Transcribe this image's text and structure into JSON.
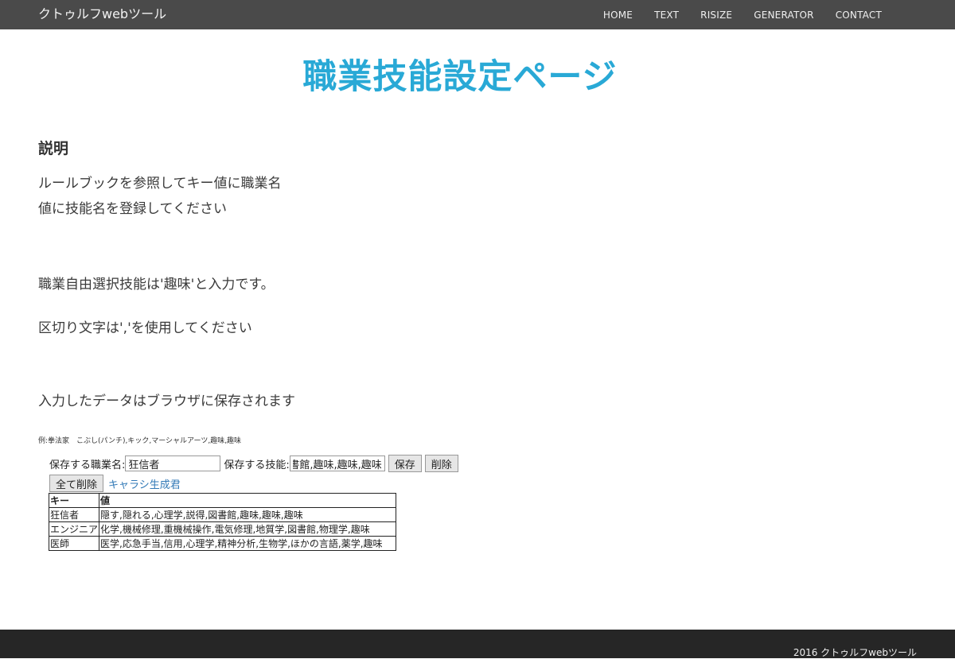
{
  "header": {
    "brand": "クトゥルフwebツール",
    "nav": [
      "HOME",
      "TEXT",
      "RISIZE",
      "GENERATOR",
      "CONTACT"
    ]
  },
  "main": {
    "title": "職業技能設定ページ",
    "section_heading": "説明",
    "descriptions": [
      "ルールブックを参照してキー値に職業名",
      "値に技能名を登録してください",
      "職業自由選択技能は'趣味'と入力です。",
      "区切り文字は','を使用してください",
      "入力したデータはブラウザに保存されます"
    ],
    "example": "例:拳法家　こぶし(パンチ),キック,マーシャルアーツ,趣味,趣味"
  },
  "form": {
    "job_label": "保存する職業名:",
    "job_value": "狂信者",
    "skill_label": "保存する技能:",
    "skill_value": "隠す,隠れる,心理学,説得,図書館,趣味,趣味,趣味",
    "save_button": "保存",
    "delete_button": "削除",
    "delete_all_button": "全て削除",
    "generator_link": "キャラシ生成君"
  },
  "table": {
    "headers": [
      "キー",
      "値"
    ],
    "rows": [
      {
        "key": "狂信者",
        "value": "隠す,隠れる,心理学,説得,図書館,趣味,趣味,趣味"
      },
      {
        "key": "エンジニア",
        "value": "化学,機械修理,重機械操作,電気修理,地質学,図書館,物理学,趣味"
      },
      {
        "key": "医師",
        "value": "医学,応急手当,信用,心理学,精神分析,生物学,ほかの言語,薬学,趣味"
      }
    ]
  },
  "footer": {
    "text": "2016  クトゥルフwebツール"
  }
}
